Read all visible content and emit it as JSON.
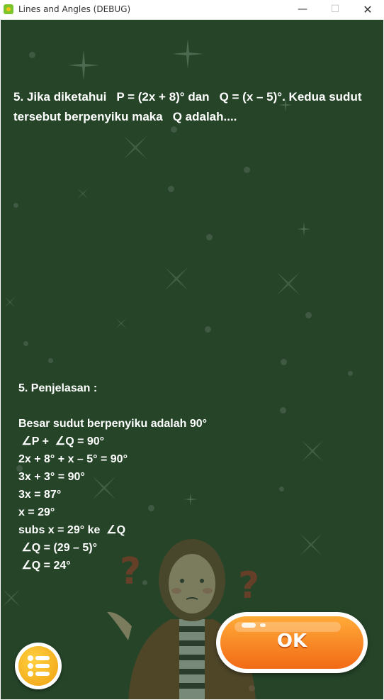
{
  "window": {
    "title": "Lines and Angles (DEBUG)",
    "minimize_icon": "minimize-icon",
    "maximize_icon": "maximize-icon",
    "close_icon": "close-icon"
  },
  "question": {
    "part1": "5. Jika diketahui",
    "part2": "P = (2x + 8)° dan",
    "part3": "Q = (x – 5)°. Kedua sudut tersebut berpenyiku maka",
    "part4": "Q adalah...."
  },
  "explanation": {
    "title": "5. Penjelasan :",
    "lines": [
      "Besar sudut berpenyiku adalah 90°",
      " ∠P +  ∠Q = 90°",
      "2x + 8° + x – 5° = 90°",
      "3x + 3° = 90°",
      "3x = 87°",
      "x = 29°",
      "subs x = 29° ke  ∠Q",
      " ∠Q = (29 – 5)°",
      " ∠Q = 24°"
    ]
  },
  "buttons": {
    "ok_label": "OK",
    "menu_icon": "list-menu-icon"
  },
  "colors": {
    "background": "#254428",
    "ok_button": "#f57a1f",
    "menu_button": "#f5b21e",
    "text": "#ffffff"
  }
}
